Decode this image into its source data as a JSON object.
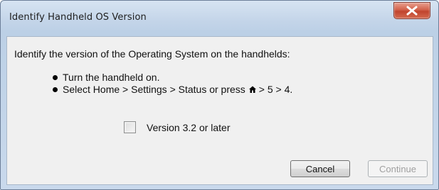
{
  "window": {
    "title": "Identify Handheld OS Version"
  },
  "icons": {
    "close": "close-x-icon",
    "home": "home-icon"
  },
  "colors": {
    "close_button": "#c9503a",
    "content_background": "#f0f0f0",
    "disabled_text": "#a0a0a0"
  },
  "main": {
    "prompt": "Identify the version of the Operating System on the handhelds:",
    "bullets": [
      {
        "text": "Turn the handheld on."
      },
      {
        "text_before_icon": "Select Home > Settings > Status or press",
        "text_after_icon": "> 5 > 4."
      }
    ],
    "checkbox": {
      "label": "Version 3.2 or later",
      "checked": false
    }
  },
  "buttons": {
    "cancel_label": "Cancel",
    "continue_label": "Continue",
    "continue_enabled": false
  }
}
